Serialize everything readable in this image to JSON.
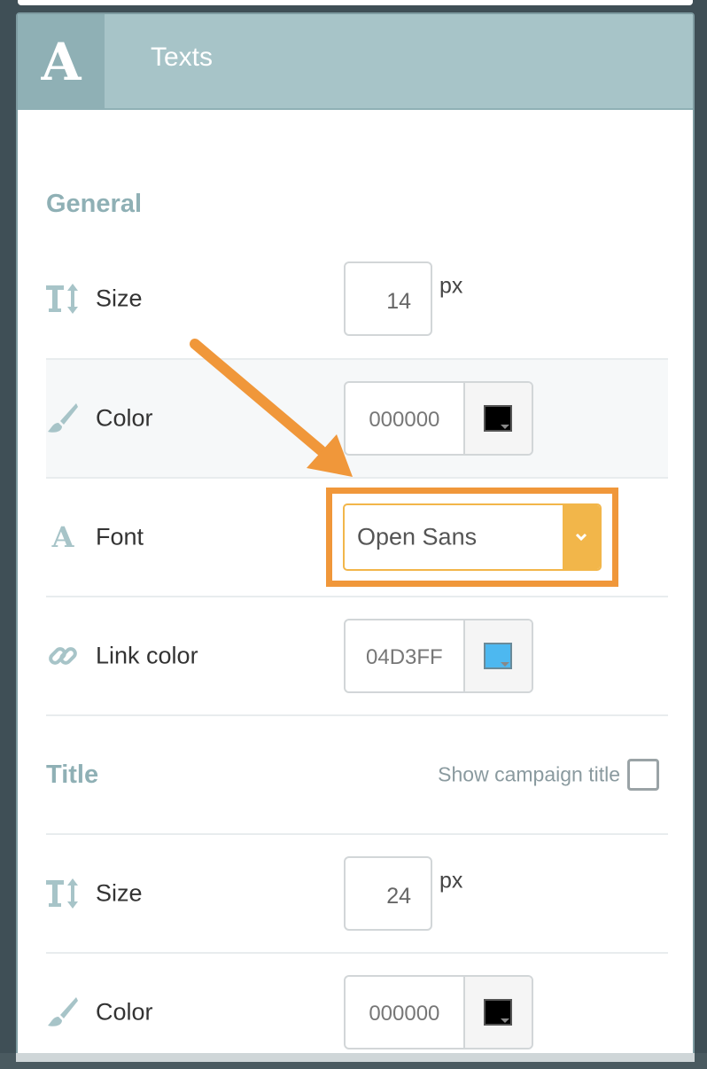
{
  "header": {
    "icon_glyph": "A",
    "title": "Texts"
  },
  "general": {
    "title": "General",
    "size": {
      "label": "Size",
      "value": "14",
      "unit": "px",
      "icon": "text-height-icon"
    },
    "color": {
      "label": "Color",
      "value": "000000",
      "swatch": "#000000",
      "icon": "paintbrush-icon"
    },
    "font": {
      "label": "Font",
      "value": "Open Sans",
      "icon_glyph": "A",
      "icon": "font-icon"
    },
    "link_color": {
      "label": "Link color",
      "value": "04D3FF",
      "swatch": "#4db8f0",
      "icon": "link-icon"
    }
  },
  "title_section": {
    "title": "Title",
    "show_title_label": "Show campaign title",
    "show_title_checked": false,
    "size": {
      "label": "Size",
      "value": "24",
      "unit": "px",
      "icon": "text-height-icon"
    },
    "color": {
      "label": "Color",
      "value": "000000",
      "swatch": "#000000",
      "icon": "paintbrush-icon"
    }
  },
  "colors": {
    "accent": "#a7c4c8",
    "annotation": "#f0973a",
    "select_accent": "#f2b64a"
  }
}
